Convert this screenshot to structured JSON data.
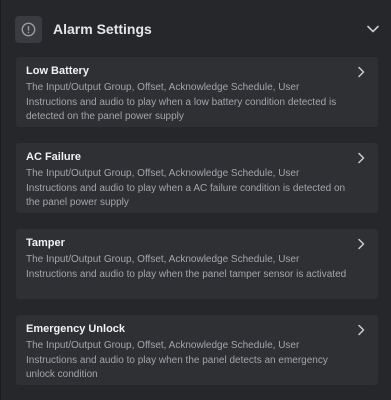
{
  "header": {
    "title": "Alarm Settings",
    "icon": "alert-circle-icon",
    "toggle_icon": "chevron-down-icon"
  },
  "alarms": [
    {
      "title": "Low Battery",
      "description": "The Input/Output Group, Offset, Acknowledge Schedule, User Instructions and audio to play when a low battery condition detected is detected on the panel power supply"
    },
    {
      "title": "AC Failure",
      "description": "The Input/Output Group, Offset, Acknowledge Schedule, User Instructions and audio to play when a AC failure condition is detected on the panel power supply"
    },
    {
      "title": "Tamper",
      "description": "The Input/Output Group, Offset, Acknowledge Schedule, User Instructions and audio to play when the panel tamper sensor is activated"
    },
    {
      "title": "Emergency Unlock",
      "description": "The Input/Output Group, Offset, Acknowledge Schedule, User Instructions and audio to play when the panel detects an emergency unlock condition"
    }
  ],
  "colors": {
    "background": "#26272b",
    "card": "#2f3034",
    "title_text": "#f0f1f3",
    "body_text": "#a3a5ab"
  }
}
